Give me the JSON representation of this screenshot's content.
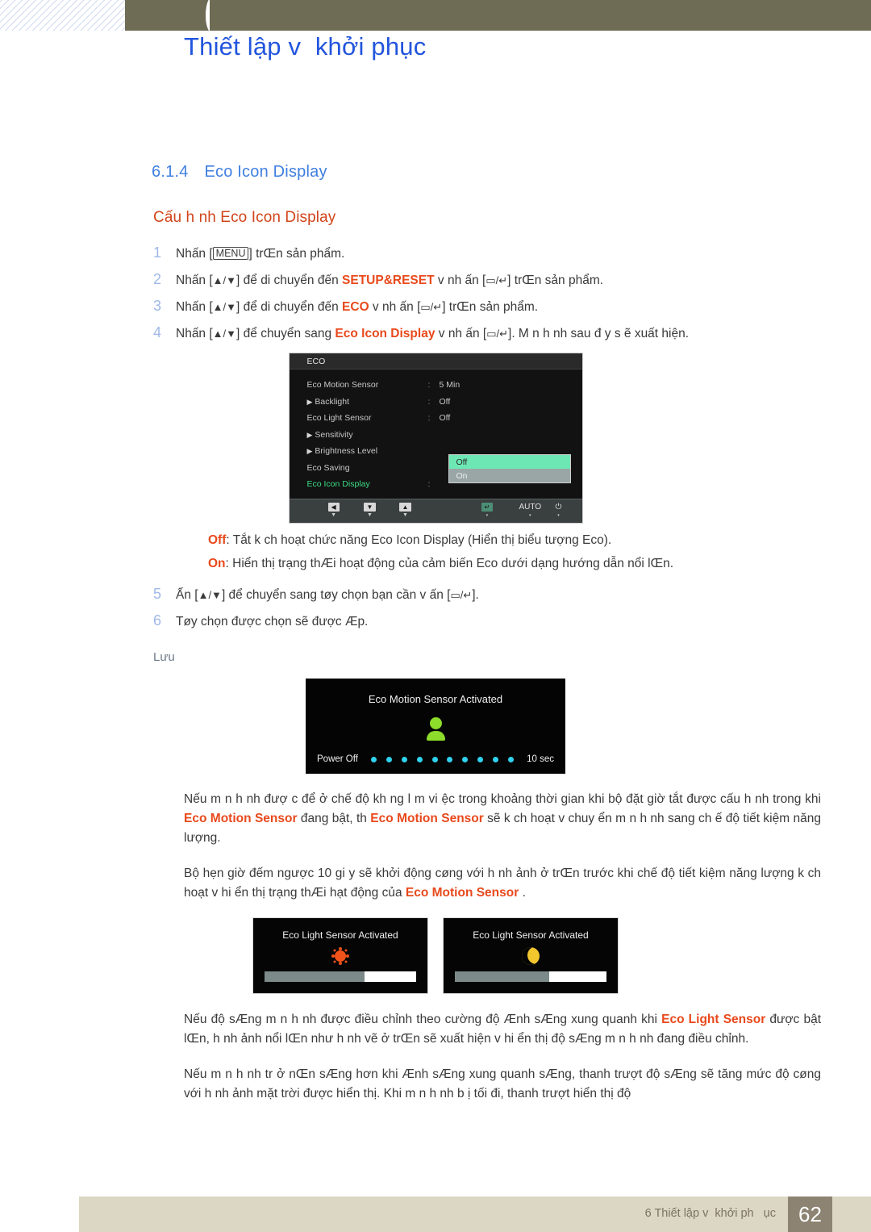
{
  "header": {
    "chapter_number": "6",
    "title": "Thiết lập v  khởi phục"
  },
  "section": {
    "number": "6.1.4",
    "title": "Eco Icon Display",
    "subtitle": "Cấu h nh Eco Icon Display"
  },
  "steps": [
    {
      "n": "1",
      "parts": [
        {
          "t": "Nhấn [",
          "style": "plain"
        },
        {
          "t": "MENU",
          "style": "keycap"
        },
        {
          "t": "] trŒn sản phẩm.",
          "style": "plain"
        }
      ]
    },
    {
      "n": "2",
      "parts": [
        {
          "t": "Nhấn [",
          "style": "plain"
        },
        {
          "t": "▲/▼",
          "style": "glyph"
        },
        {
          "t": "] để di chuyển đến ",
          "style": "plain"
        },
        {
          "t": "SETUP&RESET",
          "style": "highlight"
        },
        {
          "t": " v  nh ấn [",
          "style": "plain"
        },
        {
          "t": "▭/↵",
          "style": "glyph"
        },
        {
          "t": "] trŒn sản phẩm.",
          "style": "plain"
        }
      ]
    },
    {
      "n": "3",
      "parts": [
        {
          "t": "Nhấn [",
          "style": "plain"
        },
        {
          "t": "▲/▼",
          "style": "glyph"
        },
        {
          "t": "] để di chuyển đến ",
          "style": "plain"
        },
        {
          "t": "ECO",
          "style": "highlight"
        },
        {
          "t": " v  nh ấn [",
          "style": "plain"
        },
        {
          "t": "▭/↵",
          "style": "glyph"
        },
        {
          "t": "] trŒn sản phẩm.",
          "style": "plain"
        }
      ]
    },
    {
      "n": "4",
      "parts": [
        {
          "t": "Nhấn [",
          "style": "plain"
        },
        {
          "t": "▲/▼",
          "style": "glyph"
        },
        {
          "t": "] để chuyển sang ",
          "style": "plain"
        },
        {
          "t": "Eco Icon Display",
          "style": "highlight"
        },
        {
          "t": "  v  nh ấn [",
          "style": "plain"
        },
        {
          "t": "▭/↵",
          "style": "glyph"
        },
        {
          "t": "]. M n h nh sau  đ y s ẽ xuất hiện.",
          "style": "plain"
        }
      ]
    }
  ],
  "steps_after": [
    {
      "n": "5",
      "parts": [
        {
          "t": "Ấn [",
          "style": "plain"
        },
        {
          "t": "▲/▼",
          "style": "glyph"
        },
        {
          "t": "] để chuyển sang tøy chọn bạn cần v   ấn [",
          "style": "plain"
        },
        {
          "t": "▭/↵",
          "style": "glyph"
        },
        {
          "t": "].",
          "style": "plain"
        }
      ]
    },
    {
      "n": "6",
      "parts": [
        {
          "t": "Tøy chọn được chọn sẽ được Æp.",
          "style": "plain"
        }
      ]
    }
  ],
  "osd": {
    "title": "ECO",
    "rows": [
      {
        "label": "Eco Motion Sensor",
        "arrow": false,
        "colon": ":",
        "value": "5 Min",
        "active": false
      },
      {
        "label": "Backlight",
        "arrow": true,
        "colon": ":",
        "value": "Off",
        "active": false
      },
      {
        "label": "Eco Light Sensor",
        "arrow": false,
        "colon": ":",
        "value": "Off",
        "active": false
      },
      {
        "label": "Sensitivity",
        "arrow": true,
        "colon": "",
        "value": "",
        "active": false
      },
      {
        "label": "Brightness Level",
        "arrow": true,
        "colon": "",
        "value": "",
        "active": false
      },
      {
        "label": "Eco Saving",
        "arrow": false,
        "colon": "",
        "value": "",
        "active": false
      },
      {
        "label": "Eco Icon Display",
        "arrow": false,
        "colon": ":",
        "value": "",
        "active": true
      }
    ],
    "popup": {
      "selected": "Off",
      "unselected": "On"
    },
    "footer_buttons": [
      {
        "glyph": "◀",
        "kind": "cap",
        "tick": "▼"
      },
      {
        "glyph": "▼",
        "kind": "cap",
        "tick": "▼"
      },
      {
        "glyph": "▲",
        "kind": "cap",
        "tick": "▼"
      },
      {
        "glyph": "↵",
        "kind": "cap-green",
        "tick": "▾"
      },
      {
        "glyph": "AUTO",
        "kind": "word",
        "tick": "▾"
      },
      {
        "glyph": "⏻",
        "kind": "word",
        "tick": "▾"
      }
    ]
  },
  "descriptions": [
    {
      "key": "Off",
      "text": ": Tắt k ch hoạt chức năng Eco Icon Display (Hiển thị biểu tượng Eco)."
    },
    {
      "key": "On",
      "text": ": Hiển thị trạng thÆi hoạt động của cảm biến Eco dưới dạng hướng dẫn nổi lŒn."
    }
  ],
  "note_label": "Lưu",
  "motion_shot": {
    "caption": "Eco Motion Sensor Activated",
    "power_label": "Power Off",
    "seconds_label": "10 sec",
    "dot_count": 10,
    "icon": "person-icon"
  },
  "paragraphs": [
    {
      "parts": [
        {
          "t": "Nếu m n h nh đượ c để ở chế độ kh ng l m vi ệc trong khoảng thời gian khi bộ đặt giờ tắt được cấu h nh trong khi ",
          "style": "plain"
        },
        {
          "t": "Eco Motion Sensor",
          "style": "highlight"
        },
        {
          "t": "  đang bật, th  ",
          "style": "plain"
        },
        {
          "t": "Eco Motion Sensor",
          "style": "highlight"
        },
        {
          "t": "  sẽ k ch hoạt v  chuy ển m n h nh sang ch ế độ tiết kiệm năng lượng.",
          "style": "plain"
        }
      ]
    },
    {
      "parts": [
        {
          "t": "Bộ hẹn giờ đếm ngược 10 gi y sẽ  khởi động cøng với h nh ảnh ở trŒn trước khi chế độ tiết kiệm năng lượng k ch hoạt v  hi ển thị trạng thÆi hạt động của ",
          "style": "plain"
        },
        {
          "t": "Eco Motion Sensor",
          "style": "highlight"
        },
        {
          "t": " .",
          "style": "plain"
        }
      ]
    }
  ],
  "light_shots": [
    {
      "caption": "Eco Light Sensor Activated",
      "icon": "sun-icon",
      "fill_percent": 66
    },
    {
      "caption": "Eco Light Sensor Activated",
      "icon": "moon-icon",
      "fill_percent": 62
    }
  ],
  "paragraphs_bottom": [
    {
      "parts": [
        {
          "t": "Nếu độ sÆng m n h nh được điều chỉnh theo cường độ Ænh sÆng xung quanh khi ",
          "style": "plain"
        },
        {
          "t": "Eco Light Sensor",
          "style": "highlight"
        },
        {
          "t": "  được bật lŒn, h nh ảnh nổi lŒn như h nh vẽ ở trŒn sẽ xuất hiện v  hi ển thị độ sÆng m n h nh đang điều chỉnh.",
          "style": "plain"
        }
      ]
    },
    {
      "parts": [
        {
          "t": "Nếu m n h nh tr ở nŒn sÆng hơn khi Ænh sÆng xung quanh sÆng, thanh trượt độ sÆng sẽ tăng mức độ cøng với h nh ảnh mặt trời được hiển thị. Khi m n h nh b ị tối đi, thanh trượt hiển thị độ",
          "style": "plain"
        }
      ]
    }
  ],
  "footer": {
    "text": "6 Thiết lập v  khởi ph   ục",
    "page": "62"
  },
  "colors": {
    "header_band": "#6f6c56",
    "heading_blue": "#3f7fe0",
    "accent_orange": "#e8491c",
    "subtitle_orange": "#d1441a",
    "osd_green": "#3ddc84",
    "osd_highlight": "#6de8b4",
    "footer_band": "#dcd7c4",
    "footer_page_box": "#8d8372"
  }
}
